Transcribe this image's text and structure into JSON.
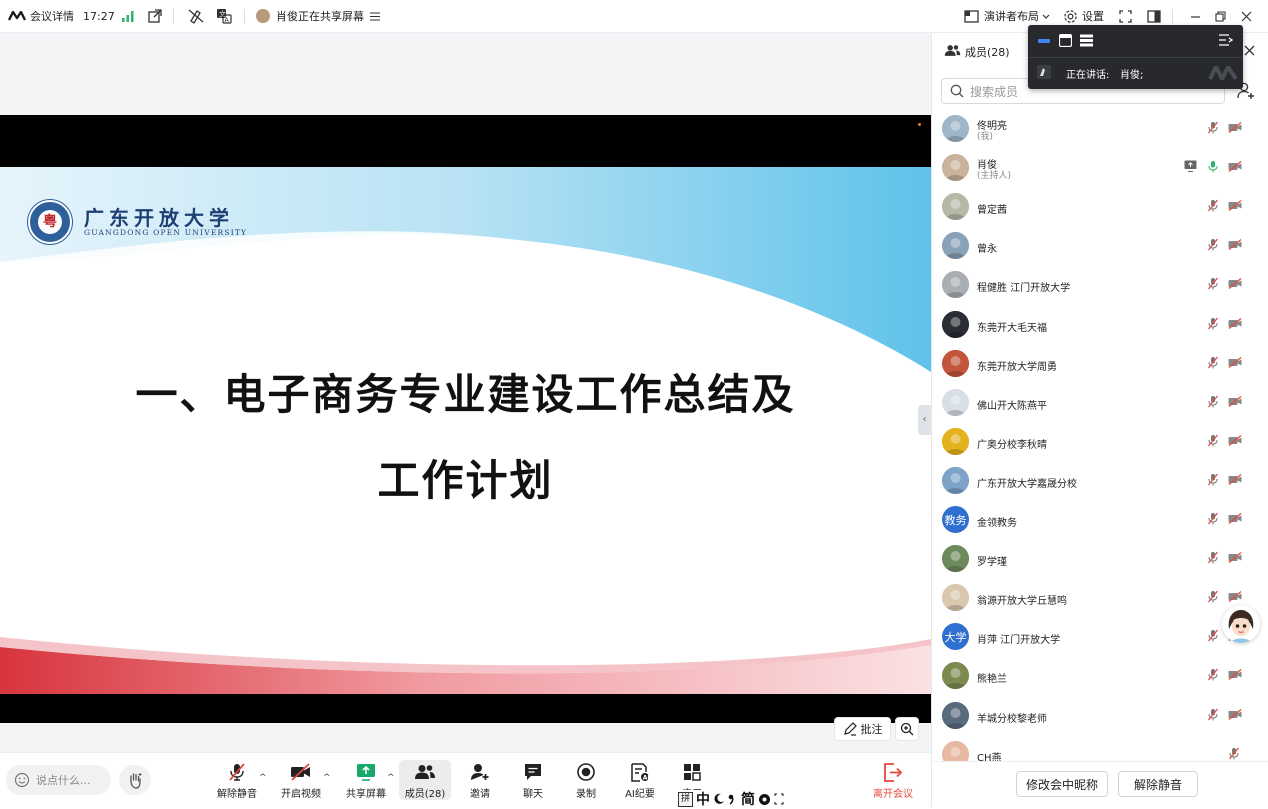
{
  "topbar": {
    "meeting_info": "会议详情",
    "time": "17:27",
    "sharer_status": "肖俊正在共享屏幕",
    "layout_label": "演讲者布局",
    "settings_label": "设置"
  },
  "slide": {
    "university_cn": "广东开放大学",
    "university_en": "GUANGDONG OPEN UNIVERSITY",
    "logo_char": "粤",
    "title_line1": "一、电子商务专业建设工作总结及",
    "title_line2": "工作计划"
  },
  "floating": {
    "annotate_label": "批注"
  },
  "bottombar": {
    "chat_placeholder": "说点什么...",
    "tools": [
      {
        "label": "解除静音"
      },
      {
        "label": "开启视频"
      },
      {
        "label": "共享屏幕"
      },
      {
        "label": "成员(28)"
      },
      {
        "label": "邀请"
      },
      {
        "label": "聊天"
      },
      {
        "label": "录制"
      },
      {
        "label": "AI纪要"
      },
      {
        "label": "应用"
      }
    ],
    "leave_label": "离开会议",
    "ime": {
      "c1": "中",
      "c2": "简"
    }
  },
  "panel": {
    "title": "成员(28)",
    "search_placeholder": "搜索成员",
    "members": [
      {
        "name": "佟明亮",
        "role": "(我)",
        "avatar": "photo",
        "color": "#9fb6c8"
      },
      {
        "name": "肖俊",
        "role": "(主持人)",
        "avatar": "photo",
        "color": "#c9b39a",
        "sharing": true,
        "mic_on": true
      },
      {
        "name": "曾定茜",
        "avatar": "photo",
        "color": "#b7b9a8"
      },
      {
        "name": "曾永",
        "avatar": "photo",
        "color": "#8aa2b8"
      },
      {
        "name": "程健胜  江门开放大学",
        "avatar": "photo",
        "color": "#a9aeb3"
      },
      {
        "name": "东莞开大毛天福",
        "avatar": "photo",
        "color": "#2a2d33"
      },
      {
        "name": "东莞开放大学周勇",
        "avatar": "photo",
        "color": "#c2553a"
      },
      {
        "name": "佛山开大陈燕平",
        "avatar": "photo",
        "color": "#d8dfe6"
      },
      {
        "name": "广奥分校李秋晴",
        "avatar": "photo",
        "color": "#e3b21c"
      },
      {
        "name": "广东开放大学嘉晟分校",
        "avatar": "photo",
        "color": "#7da3c9"
      },
      {
        "name": "金领教务",
        "avatar": "text",
        "text": "教务",
        "color": "#2f6fd0"
      },
      {
        "name": "罗学瑾",
        "avatar": "photo",
        "color": "#6d8a5c"
      },
      {
        "name": "翁源开放大学丘慧鸣",
        "avatar": "photo",
        "color": "#d9c8ae"
      },
      {
        "name": "肖萍 江门开放大学",
        "avatar": "text",
        "text": "大学",
        "color": "#2f6fd0"
      },
      {
        "name": "熊艳兰",
        "avatar": "photo",
        "color": "#7c8a4f"
      },
      {
        "name": "羊城分校黎老师",
        "avatar": "photo",
        "color": "#5a6a7d"
      },
      {
        "name": "CH燕",
        "avatar": "photo",
        "color": "#e6b9a0"
      }
    ],
    "rename_button": "修改会中昵称",
    "unmute_button": "解除静音"
  },
  "popup": {
    "speaking_label": "正在讲话:",
    "speaker": "肖俊;"
  },
  "colors": {
    "accent": "#1f6fe5",
    "leave_red": "#e5483c",
    "mic_green": "#2fb56a",
    "muted_red": "#e0493f"
  }
}
